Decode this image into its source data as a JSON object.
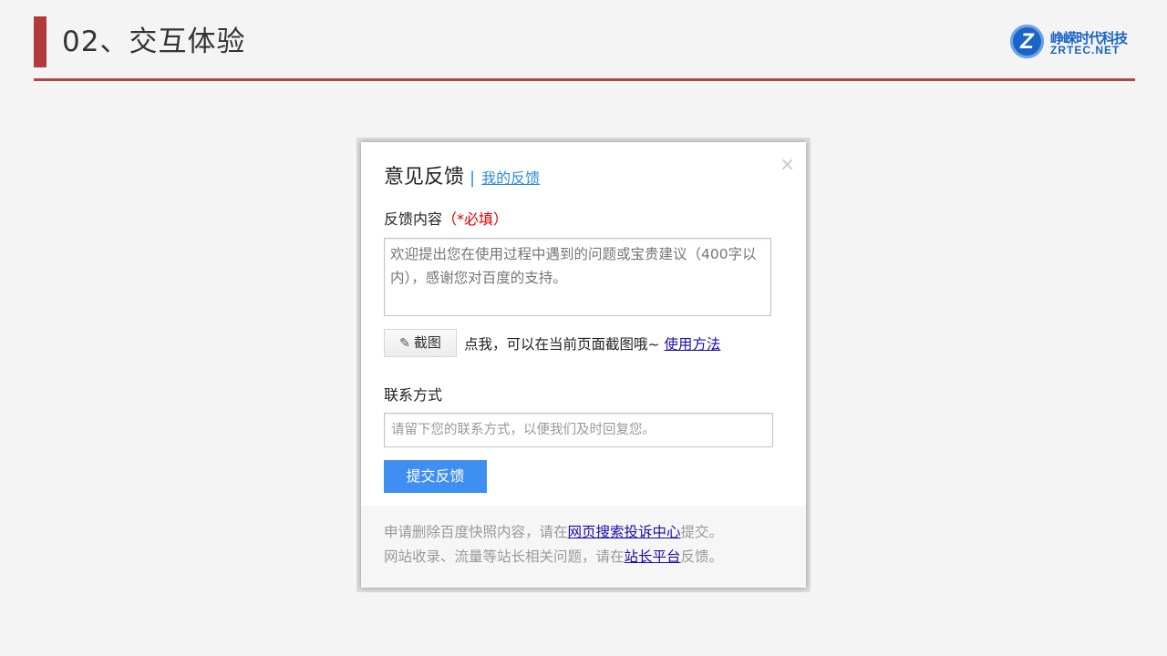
{
  "slide": {
    "title": "02、交互体验"
  },
  "logo": {
    "mark": "Z",
    "cn": "峥嵘时代科技",
    "en": "ZRTEC.NET",
    "color": "#1b64c6"
  },
  "dialog": {
    "title": "意见反馈",
    "separator": "|",
    "my_feedback_link": "我的反馈",
    "close_icon": "×",
    "content_label": "反馈内容",
    "required_mark": "（*必填）",
    "content_placeholder": "欢迎提出您在使用过程中遇到的问题或宝贵建议（400字以内），感谢您对百度的支持。",
    "screenshot_button": "截图",
    "screenshot_icon": "✎",
    "screenshot_hint": "点我，可以在当前页面截图哦~ ",
    "howto_link": "使用方法",
    "contact_label": "联系方式",
    "contact_placeholder": "请留下您的联系方式，以便我们及时回复您。",
    "submit_button": "提交反馈",
    "footer": {
      "line1_prefix": "申请删除百度快照内容，请在",
      "line1_link": "网页搜索投诉中心",
      "line1_suffix": "提交。",
      "line2_prefix": "网站收录、流量等站长相关问题，请在",
      "line2_link": "站长平台",
      "line2_suffix": "反馈。"
    }
  },
  "colors": {
    "accent_red": "#b23a3a",
    "link_blue": "#2f8bd9",
    "submit_blue": "#3f8ef2",
    "required_red": "#dd0000"
  }
}
